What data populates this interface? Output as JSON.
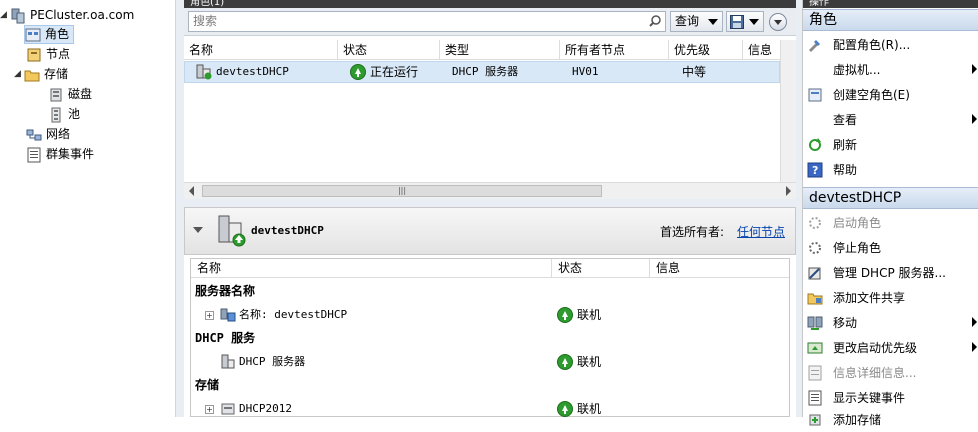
{
  "tree": {
    "root": "PECluster.oa.com",
    "items": [
      "角色",
      "节点",
      "存储",
      "磁盘",
      "池",
      "网络",
      "群集事件"
    ]
  },
  "roles": {
    "title": "角色(1)",
    "search_placeholder": "搜索",
    "query_label": "查询",
    "columns": [
      "名称",
      "状态",
      "类型",
      "所有者节点",
      "优先级",
      "信息"
    ],
    "row": {
      "name": "devtestDHCP",
      "status": "正在运行",
      "type": "DHCP 服务器",
      "owner": "HV01",
      "priority": "中等",
      "info": ""
    }
  },
  "detail": {
    "name": "devtestDHCP",
    "preferred_owner_label": "首选所有者:",
    "preferred_owner_link": "任何节点",
    "columns": [
      "名称",
      "状态",
      "信息"
    ],
    "groups": [
      {
        "title": "服务器名称",
        "items": [
          {
            "name": "名称: devtestDHCP",
            "status": "联机",
            "expandable": true
          }
        ]
      },
      {
        "title": "DHCP 服务",
        "items": [
          {
            "name": "DHCP 服务器",
            "status": "联机",
            "expandable": false
          }
        ]
      },
      {
        "title": "存储",
        "items": [
          {
            "name": "DHCP2012",
            "status": "联机",
            "expandable": true
          }
        ]
      }
    ]
  },
  "actions": {
    "header_top": "操作",
    "section1_title": "角色",
    "section1": [
      {
        "label": "配置角色(R)...",
        "submenu": false,
        "disabled": false
      },
      {
        "label": "虚拟机...",
        "submenu": true,
        "disabled": false
      },
      {
        "label": "创建空角色(E)",
        "submenu": false,
        "disabled": false
      },
      {
        "label": "查看",
        "submenu": true,
        "disabled": false
      },
      {
        "label": "刷新",
        "submenu": false,
        "disabled": false
      },
      {
        "label": "帮助",
        "submenu": false,
        "disabled": false
      }
    ],
    "section2_title": "devtestDHCP",
    "section2": [
      {
        "label": "启动角色",
        "submenu": false,
        "disabled": true
      },
      {
        "label": "停止角色",
        "submenu": false,
        "disabled": false
      },
      {
        "label": "管理 DHCP 服务器...",
        "submenu": false,
        "disabled": false
      },
      {
        "label": "添加文件共享",
        "submenu": false,
        "disabled": false
      },
      {
        "label": "移动",
        "submenu": true,
        "disabled": false
      },
      {
        "label": "更改启动优先级",
        "submenu": true,
        "disabled": false
      },
      {
        "label": "信息详细信息...",
        "submenu": false,
        "disabled": true
      },
      {
        "label": "显示关键事件",
        "submenu": false,
        "disabled": false
      },
      {
        "label": "添加存储",
        "submenu": false,
        "disabled": false
      }
    ]
  },
  "colors": {
    "selection": "#d9e8f7",
    "link": "#0645ad",
    "online": "#2e9b2e"
  }
}
